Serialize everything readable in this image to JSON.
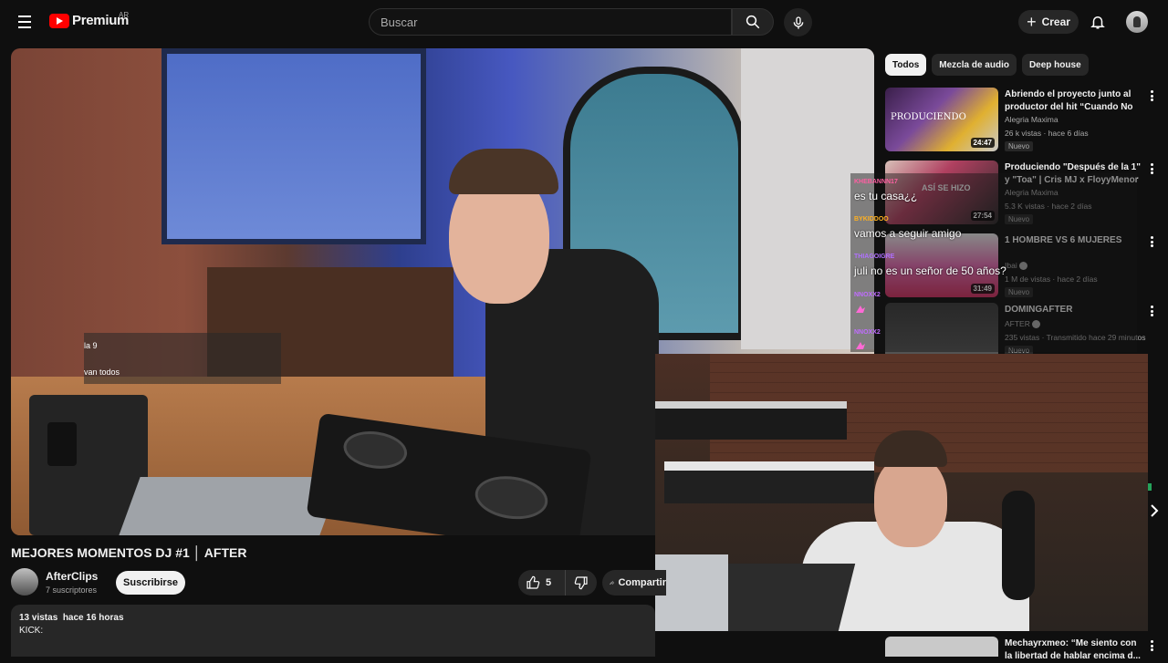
{
  "header": {
    "logo_text": "Premium",
    "country_code": "AR",
    "search_placeholder": "Buscar",
    "create_label": "Crear"
  },
  "video": {
    "overlay_chat": [
      {
        "message": "la 9"
      },
      {
        "message": "van todos"
      }
    ],
    "title": "MEJORES MOMENTOS DJ #1 │ AFTER",
    "channel": "AfterClips",
    "subscribers": "7 suscriptores",
    "subscribe_label": "Suscribirse",
    "likes": "5",
    "share_label": "Compartir",
    "views": "13 vistas",
    "uploaded": "hace 16 horas",
    "description": "KICK:"
  },
  "chips": [
    "Todos",
    "Mezcla de audio",
    "Deep house"
  ],
  "recommendations": [
    {
      "title": "Abriendo el proyecto junto al productor del hit “Cuando No ...",
      "channel": "Alegria Maxima",
      "meta": "26 k vistas · hace 6 días",
      "badge": "Nuevo",
      "duration": "24:47",
      "thumb_text": "PRODUCIENDO"
    },
    {
      "title": "Produciendo \"Después de la 1\" y \"Toa\" | Cris MJ x FloyyMenor",
      "channel": "Alegria Maxima",
      "meta": "5.3 K vistas · hace 2 días",
      "badge": "Nuevo",
      "duration": "27:54",
      "thumb_text": "ASÍ SE HIZO"
    },
    {
      "title": "1 HOMBRE VS 6 MUJERES",
      "channel": "Ibai",
      "meta": "1 M de vistas · hace 2 días",
      "badge": "Nuevo",
      "duration": "31:49",
      "thumb_text": ""
    },
    {
      "title": "DOMINGAFTER",
      "channel": "AFTER",
      "meta": "235 vistas · Transmitido hace 29 minutos",
      "badge": "Nuevo",
      "duration": "",
      "thumb_text": ""
    }
  ],
  "side_chat": [
    {
      "user": "KHEBANNN17",
      "message": "es tu casa¿¿",
      "color": "#ff5fa2"
    },
    {
      "user": "BYKIDDOO",
      "message": "vamos a seguir amigo",
      "color": "#ffb020"
    },
    {
      "user": "THIAGOIGRE",
      "message": "juli no es un señor de 50 años?",
      "color": "#b070ff"
    },
    {
      "user": "NNOXX2",
      "message": "",
      "color": "#c06cff"
    },
    {
      "user": "NNOXX2",
      "message": "",
      "color": "#c06cff"
    }
  ],
  "bottom_recommendation": {
    "title": "Mechayrxmeo: “Me siento con la libertad de hablar encima d..."
  },
  "colors": {
    "background": "#0f0f0f",
    "brand_red": "#ff0000",
    "chip_bg": "#272727"
  },
  "icons": [
    "menu-icon",
    "youtube-logo-icon",
    "search-icon",
    "microphone-icon",
    "plus-icon",
    "bell-icon",
    "like-icon",
    "dislike-icon",
    "share-icon",
    "more-vert-icon",
    "chevron-right-icon"
  ]
}
